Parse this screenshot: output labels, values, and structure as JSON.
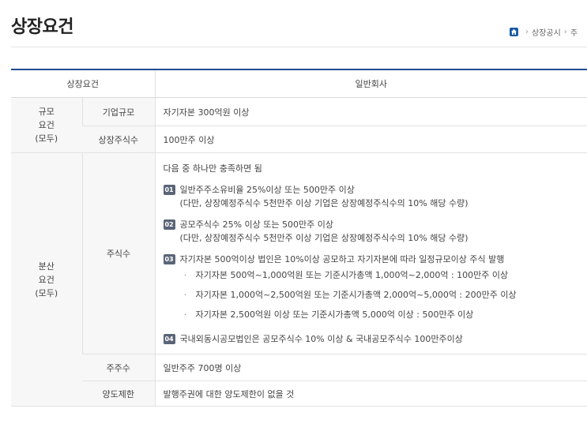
{
  "page": {
    "title": "상장요건",
    "breadcrumb": [
      "상장공시",
      "주"
    ]
  },
  "table": {
    "header": {
      "col1": "상장요건",
      "col2": "일반회사"
    },
    "scale_group": "규모\n요건\n(모두)",
    "scale_rows": [
      {
        "label": "기업규모",
        "value": "자기자본 300억원 이상"
      },
      {
        "label": "상장주식수",
        "value": "100만주 이상"
      }
    ],
    "dist_group": "분산\n요건\n(모두)",
    "shares": {
      "label": "주식수",
      "intro": "다음 중 하나만 충족하면 됨",
      "items": [
        {
          "badge": "01",
          "lines": [
            "일반주주소유비율 25%이상 또는 500만주 이상",
            "(다만, 상장예정주식수 5천만주 이상 기업은 상장예정주식수의 10% 해당 수량)"
          ]
        },
        {
          "badge": "02",
          "lines": [
            "공모주식수 25% 이상 또는 500만주 이상",
            "(다만, 상장예정주식수 5천만주 이상 기업은 상장예정주식수의 10% 해당 수량)"
          ]
        },
        {
          "badge": "03",
          "lines": [
            "자기자본 500억이상 법인은 10%이상 공모하고 자기자본에 따라 일정규모이상 주식 발행"
          ],
          "subitems": [
            "자기자본 500억~1,000억원 또는 기준시가총액 1,000억~2,000억 : 100만주 이상",
            "자기자본 1,000억~2,500억원 또는 기준시가총액 2,000억~5,000억 : 200만주 이상",
            "자기자본 2,500억원 이상 또는 기준시가총액 5,000억 이상 : 500만주 이상"
          ]
        },
        {
          "badge": "04",
          "lines": [
            "국내외동시공모법인은 공모주식수 10% 이상 & 국내공모주식수 100만주이상"
          ]
        }
      ]
    },
    "dist_rows": [
      {
        "label": "주주수",
        "value": "일반주주 700명 이상"
      },
      {
        "label": "양도제한",
        "value": "발행주권에 대한 양도제한이 없을 것"
      }
    ]
  }
}
